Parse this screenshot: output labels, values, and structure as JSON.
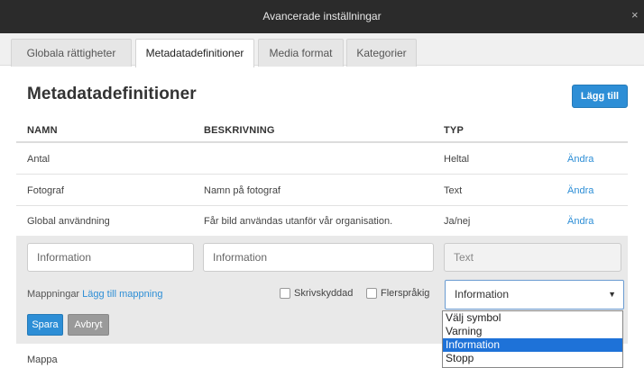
{
  "window": {
    "title": "Avancerade inställningar",
    "close_glyph": "×"
  },
  "tabs": [
    {
      "label": "Globala rättigheter",
      "active": false
    },
    {
      "label": "Metadatadefinitioner",
      "active": true
    },
    {
      "label": "Media format",
      "active": false
    },
    {
      "label": "Kategorier",
      "active": false
    }
  ],
  "section": {
    "title": "Metadatadefinitioner",
    "add_button": "Lägg till"
  },
  "table": {
    "headers": {
      "name": "NAMN",
      "description": "BESKRIVNING",
      "type": "TYP"
    },
    "rows": [
      {
        "name": "Antal",
        "description": "",
        "type": "Heltal",
        "action": "Ändra"
      },
      {
        "name": "Fotograf",
        "description": "Namn på fotograf",
        "type": "Text",
        "action": "Ändra"
      },
      {
        "name": "Global användning",
        "description": "Får bild användas utanför vår organisation.",
        "type": "Ja/nej",
        "action": "Ändra"
      }
    ],
    "last_row_name": "Mappa"
  },
  "edit": {
    "name_value": "Information",
    "description_value": "Information",
    "type_value": "Text",
    "mappings_label": "Mappningar",
    "add_mapping_link": "Lägg till mappning",
    "readonly_label": "Skrivskyddad",
    "multilingual_label": "Flerspråkig",
    "symbol_select_value": "Information",
    "save_button": "Spara",
    "cancel_button": "Avbryt"
  },
  "symbol_dropdown": {
    "options": [
      "Välj symbol",
      "Varning",
      "Information",
      "Stopp"
    ],
    "selected_index": 2
  },
  "colors": {
    "accent": "#2d8ed6",
    "titlebar": "#2b2b2b",
    "selection": "#1e72d8"
  },
  "icons": {
    "close": "close-icon",
    "select_arrow": "chevron-down-icon"
  }
}
